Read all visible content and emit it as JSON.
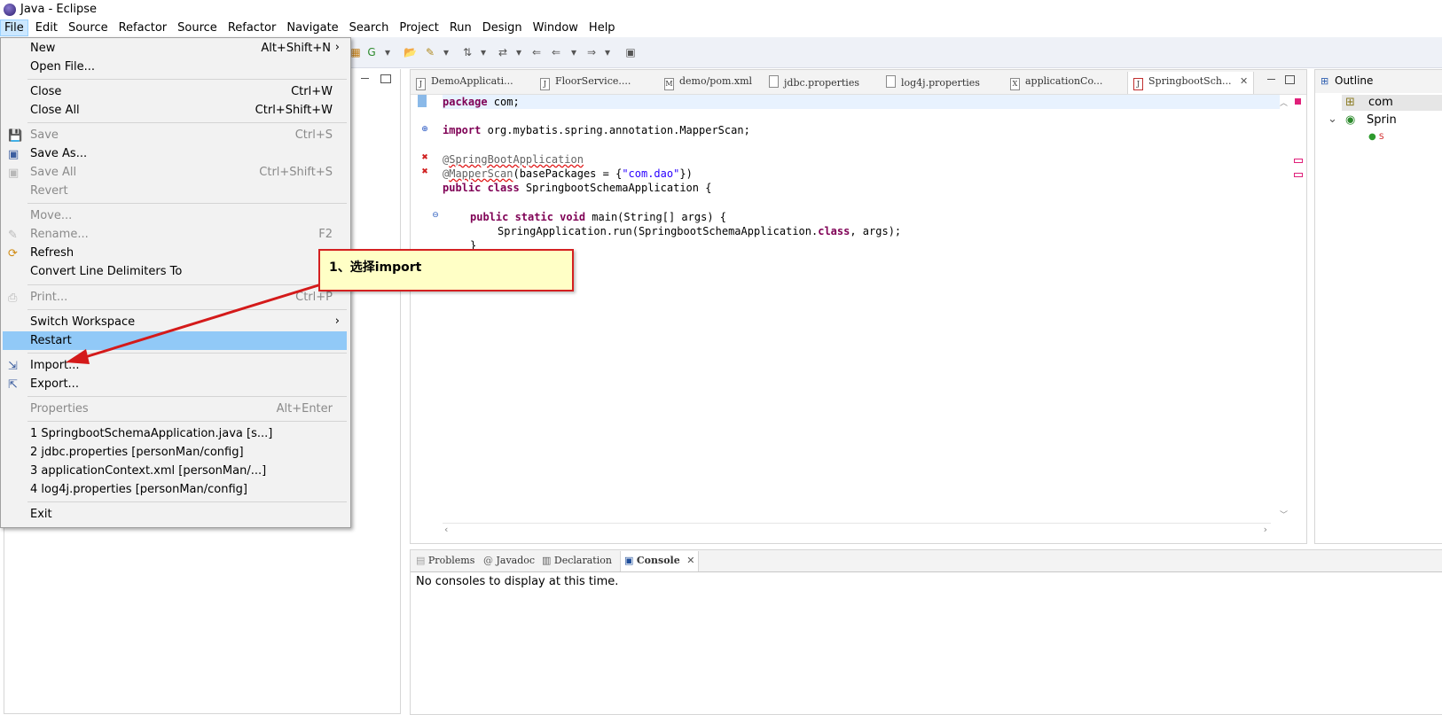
{
  "window": {
    "title": "Java - Eclipse"
  },
  "menubar": [
    "File",
    "Edit",
    "Source",
    "Refactor",
    "Source",
    "Refactor",
    "Navigate",
    "Search",
    "Project",
    "Run",
    "Design",
    "Window",
    "Help"
  ],
  "file_menu": {
    "new": {
      "label": "New",
      "shortcut": "Alt+Shift+N"
    },
    "open_file": {
      "label": "Open File..."
    },
    "close": {
      "label": "Close",
      "shortcut": "Ctrl+W"
    },
    "close_all": {
      "label": "Close All",
      "shortcut": "Ctrl+Shift+W"
    },
    "save": {
      "label": "Save",
      "shortcut": "Ctrl+S"
    },
    "save_as": {
      "label": "Save As..."
    },
    "save_all": {
      "label": "Save All",
      "shortcut": "Ctrl+Shift+S"
    },
    "revert": {
      "label": "Revert"
    },
    "move": {
      "label": "Move..."
    },
    "rename": {
      "label": "Rename...",
      "shortcut": "F2"
    },
    "refresh": {
      "label": "Refresh"
    },
    "convert": {
      "label": "Convert Line Delimiters To"
    },
    "print": {
      "label": "Print...",
      "shortcut": "Ctrl+P"
    },
    "switch_workspace": {
      "label": "Switch Workspace"
    },
    "restart": {
      "label": "Restart"
    },
    "import": {
      "label": "Import..."
    },
    "export": {
      "label": "Export..."
    },
    "properties": {
      "label": "Properties",
      "shortcut": "Alt+Enter"
    },
    "recent_1": {
      "label": "1 SpringbootSchemaApplication.java  [s...]"
    },
    "recent_2": {
      "label": "2 jdbc.properties  [personMan/config]"
    },
    "recent_3": {
      "label": "3 applicationContext.xml  [personMan/...]"
    },
    "recent_4": {
      "label": "4 log4j.properties  [personMan/config]"
    },
    "exit": {
      "label": "Exit"
    }
  },
  "editor_tabs": [
    {
      "label": "DemoApplicati...",
      "icon": "J"
    },
    {
      "label": "FloorService....",
      "icon": "J"
    },
    {
      "label": "demo/pom.xml",
      "icon": "M"
    },
    {
      "label": "jdbc.properties",
      "icon": ""
    },
    {
      "label": "log4j.properties",
      "icon": ""
    },
    {
      "label": "applicationCo...",
      "icon": "X"
    },
    {
      "label": "SpringbootSch...",
      "icon": "J"
    }
  ],
  "code": {
    "l1_kw": "package",
    "l1_rest": " com;",
    "l2_kw": "import",
    "l2_rest": " org.mybatis.spring.annotation.MapperScan;",
    "l3_at": "@",
    "l3_ann": "SpringBootApplication",
    "l4_at": "@",
    "l4_ann": "MapperScan",
    "l4_mid": "(basePackages = {",
    "l4_str": "\"com.dao\"",
    "l4_end": "})",
    "l5_kw": "public class",
    "l5_rest": " SpringbootSchemaApplication {",
    "l6_kw": "public static void",
    "l6_rest": " main(String[] args) {",
    "l7_a": "SpringApplication.run(SpringbootSchemaApplication.",
    "l7_kw": "class",
    "l7_b": ", args);",
    "l8": "}"
  },
  "outline": {
    "title": "Outline",
    "item1": "com",
    "item2": "Sprin"
  },
  "bottom_tabs": [
    "Problems",
    "Javadoc",
    "Declaration",
    "Console"
  ],
  "console": {
    "message": "No consoles to display at this time."
  },
  "callout": {
    "text": "1、选择import"
  },
  "colors": {
    "highlight": "#91c9f7",
    "callout_border": "#d42020",
    "callout_bg": "#ffffc6",
    "arrow": "#d41a1a",
    "keyword": "#7f0055",
    "string": "#2a00ff"
  }
}
